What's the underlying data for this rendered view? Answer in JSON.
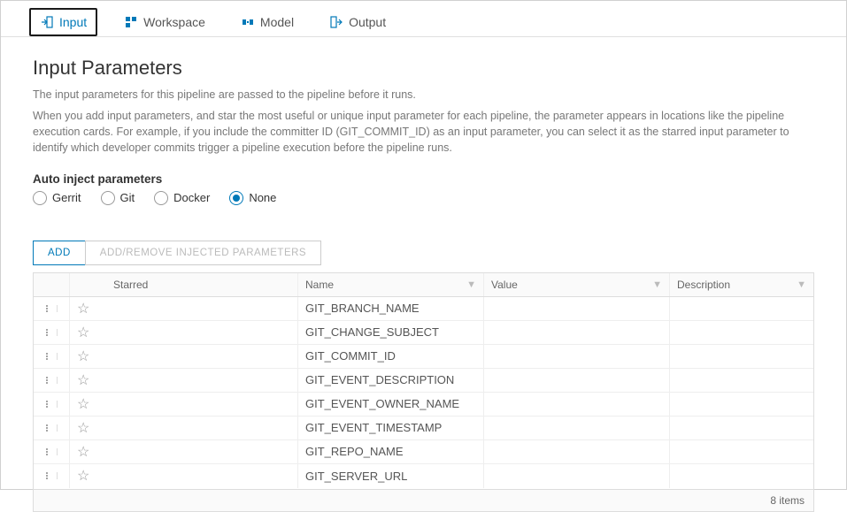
{
  "tabs": [
    {
      "label": "Input",
      "active": true
    },
    {
      "label": "Workspace",
      "active": false
    },
    {
      "label": "Model",
      "active": false
    },
    {
      "label": "Output",
      "active": false
    }
  ],
  "page": {
    "title": "Input Parameters",
    "desc1": "The input parameters for this pipeline are passed to the pipeline before it runs.",
    "desc2": "When you add input parameters, and star the most useful or unique input parameter for each pipeline, the parameter appears in locations like the pipeline execution cards. For example, if you include the committer ID (GIT_COMMIT_ID) as an input parameter, you can select it as the starred input parameter to identify which developer commits trigger a pipeline execution before the pipeline runs."
  },
  "autoInject": {
    "label": "Auto inject parameters",
    "options": [
      "Gerrit",
      "Git",
      "Docker",
      "None"
    ],
    "selected": "None"
  },
  "buttons": {
    "add": "ADD",
    "addRemove": "ADD/REMOVE INJECTED PARAMETERS"
  },
  "table": {
    "headers": {
      "starred": "Starred",
      "name": "Name",
      "value": "Value",
      "description": "Description"
    },
    "rows": [
      {
        "name": "GIT_BRANCH_NAME",
        "value": "",
        "description": ""
      },
      {
        "name": "GIT_CHANGE_SUBJECT",
        "value": "",
        "description": ""
      },
      {
        "name": "GIT_COMMIT_ID",
        "value": "",
        "description": ""
      },
      {
        "name": "GIT_EVENT_DESCRIPTION",
        "value": "",
        "description": ""
      },
      {
        "name": "GIT_EVENT_OWNER_NAME",
        "value": "",
        "description": ""
      },
      {
        "name": "GIT_EVENT_TIMESTAMP",
        "value": "",
        "description": ""
      },
      {
        "name": "GIT_REPO_NAME",
        "value": "",
        "description": ""
      },
      {
        "name": "GIT_SERVER_URL",
        "value": "",
        "description": ""
      }
    ],
    "footer": "8 items"
  }
}
